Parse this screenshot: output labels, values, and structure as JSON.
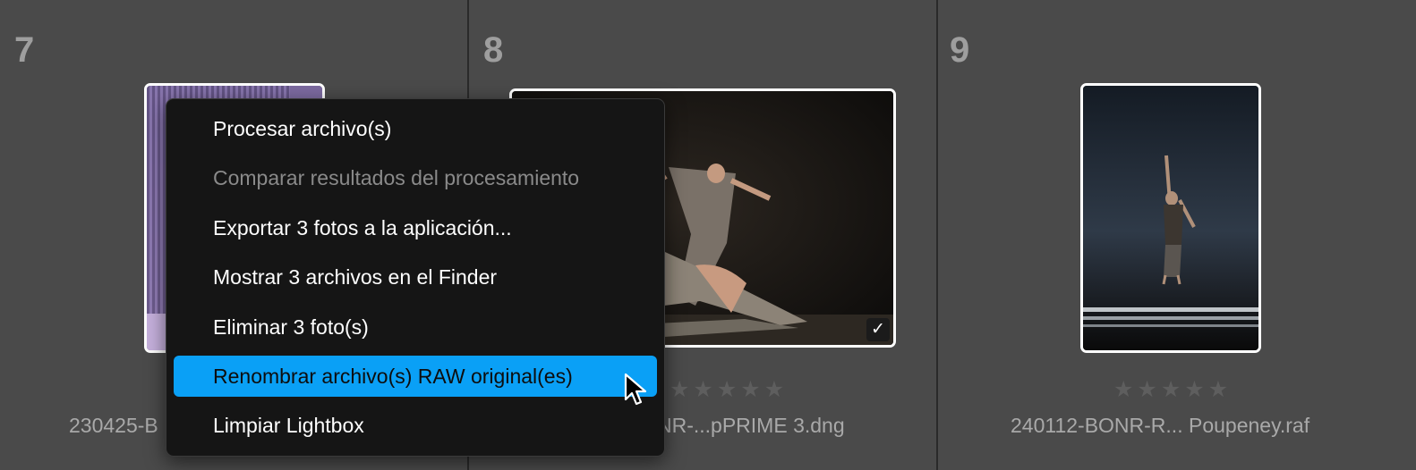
{
  "cells": [
    {
      "number": "7",
      "caption": "230425-B"
    },
    {
      "number": "8",
      "caption": "NR-...pPRIME 3.dng",
      "rating_stars": 0
    },
    {
      "number": "9",
      "caption": "240112-BONR-R... Poupeney.raf",
      "rating_stars": 0
    }
  ],
  "star_glyph": "★",
  "check_glyph": "✓",
  "context_menu": {
    "items": [
      {
        "label": "Procesar archivo(s)",
        "enabled": true,
        "highlighted": false
      },
      {
        "label": "Comparar resultados del procesamiento",
        "enabled": false,
        "highlighted": false
      },
      {
        "label": "Exportar 3 fotos a la aplicación...",
        "enabled": true,
        "highlighted": false
      },
      {
        "label": "Mostrar 3 archivos en el Finder",
        "enabled": true,
        "highlighted": false
      },
      {
        "label": "Eliminar 3 foto(s)",
        "enabled": true,
        "highlighted": false
      },
      {
        "label": "Renombrar archivo(s) RAW original(es)",
        "enabled": true,
        "highlighted": true
      },
      {
        "label": "Limpiar Lightbox",
        "enabled": true,
        "highlighted": false
      }
    ]
  },
  "colors": {
    "background": "#4a4a4a",
    "menu_background": "#151515",
    "menu_highlight": "#0aa0f6",
    "selection_border": "#ffffff"
  }
}
